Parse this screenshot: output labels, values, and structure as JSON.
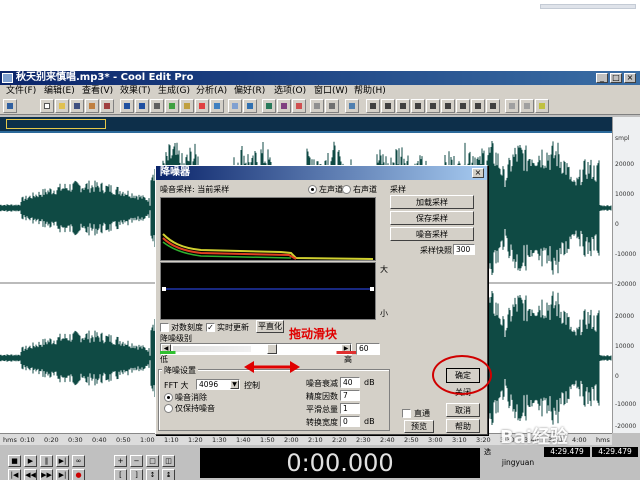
{
  "app": {
    "title": "秋天别来慎唱.mp3* - Cool Edit Pro",
    "window_buttons": [
      "_",
      "□",
      "×"
    ]
  },
  "menu": [
    "文件(F)",
    "编辑(E)",
    "查看(V)",
    "效果(T)",
    "生成(G)",
    "分析(A)",
    "偏好(R)",
    "选项(O)",
    "窗口(W)",
    "帮助(H)"
  ],
  "ruler_right": [
    "smpl",
    "20000",
    "10000",
    "0",
    "-10000",
    "-20000",
    "20000",
    "10000",
    "0",
    "-10000",
    "-20000"
  ],
  "timeline": [
    "hms",
    "0:10",
    "0:20",
    "0:30",
    "0:40",
    "0:50",
    "1:00",
    "1:10",
    "1:20",
    "1:30",
    "1:40",
    "1:50",
    "2:00",
    "2:10",
    "2:20",
    "2:30",
    "2:40",
    "2:50",
    "3:00",
    "3:10",
    "3:20",
    "3:30",
    "3:40",
    "3:50",
    "4:00",
    "hms"
  ],
  "time_display": "0:00.000",
  "status": {
    "user": "jingyuan",
    "begin": "4:29.479",
    "end": "4:29.479",
    "sel_label": "选"
  },
  "dialog": {
    "title": "降噪器",
    "close": "×",
    "noise_sample_label": "噪音采样: 当前采样",
    "left_channel": "左声道",
    "right_channel": "右声道",
    "sample_group": "采样",
    "load_sample": "加载采样",
    "save_sample": "保存采样",
    "get_sample": "噪音采样",
    "snapshots_label": "采样快照",
    "snapshots_value": "300",
    "y_high": "大",
    "y_low": "小",
    "log_scale": "对数刻度",
    "live_update": "实时更新",
    "flatten": "平直化",
    "level_label": "降噪级别",
    "level_low": "低",
    "level_high": "高",
    "level_value": "60",
    "settings_group": "降噪设置",
    "fft_label": "FFT 大",
    "fft_value": "4096",
    "control_label": "控制",
    "remove_noise": "噪音消除",
    "keep_noise": "仅保持噪音",
    "reduce_by_label": "噪音衰减",
    "reduce_by_value": "40",
    "reduce_by_unit": "dB",
    "precision_label": "精度因数",
    "precision_value": "7",
    "smoothing_label": "平滑总量",
    "smoothing_value": "1",
    "transition_label": "转换宽度",
    "transition_value": "0",
    "transition_unit": "dB",
    "bypass": "直通",
    "ok": "确定",
    "close_btn": "关闭",
    "cancel": "取消",
    "preview": "预览",
    "help": "帮助"
  },
  "annotation": {
    "text": "拖动滑块"
  },
  "watermark": "Bai经验"
}
